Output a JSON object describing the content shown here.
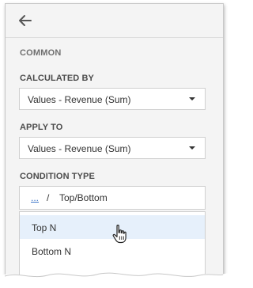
{
  "header": {
    "back_icon": "arrow-left-icon"
  },
  "section": {
    "title": "COMMON"
  },
  "calculated_by": {
    "label": "CALCULATED BY",
    "value": "Values - Revenue (Sum)"
  },
  "apply_to": {
    "label": "APPLY TO",
    "value": "Values - Revenue (Sum)"
  },
  "condition_type": {
    "label": "CONDITION TYPE",
    "breadcrumb_link": "...",
    "separator": "/",
    "current": "Top/Bottom",
    "items": [
      {
        "label": "Top N",
        "hovered": true
      },
      {
        "label": "Bottom N",
        "hovered": false
      }
    ]
  },
  "colors": {
    "panel_bg": "#f4f4f4",
    "hover_bg": "#e6f0fb",
    "link": "#3b74c8"
  }
}
